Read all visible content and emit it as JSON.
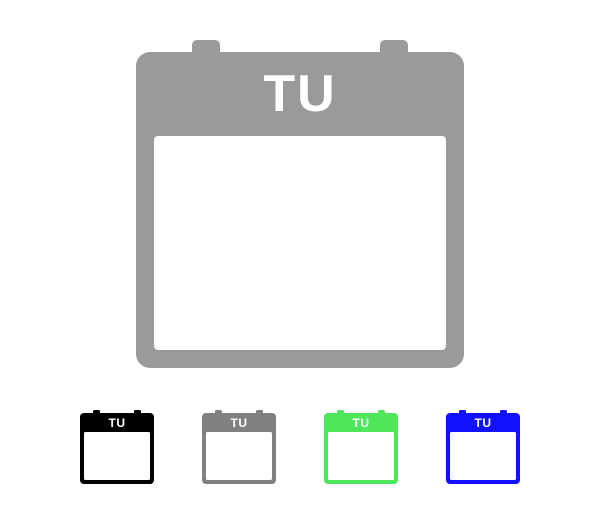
{
  "icon_label": "TU",
  "main": {
    "color": "#9a9a9a"
  },
  "variants": [
    {
      "name": "black",
      "color": "#000000"
    },
    {
      "name": "gray",
      "color": "#808080"
    },
    {
      "name": "green",
      "color": "#4fe65a"
    },
    {
      "name": "blue",
      "color": "#1111ff"
    }
  ]
}
